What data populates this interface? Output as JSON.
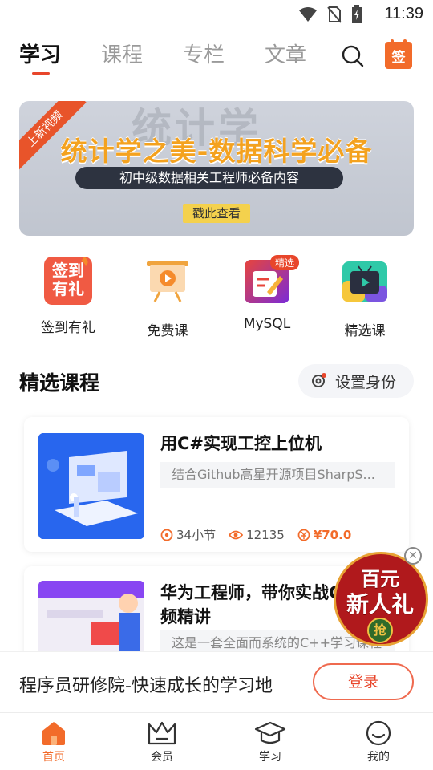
{
  "status_bar": {
    "time": "11:39"
  },
  "top_tabs": [
    {
      "label": "学习",
      "active": true
    },
    {
      "label": "课程",
      "active": false
    },
    {
      "label": "专栏",
      "active": false
    },
    {
      "label": "文章",
      "active": false
    }
  ],
  "sign_badge": "签",
  "banner": {
    "ribbon": "上新视频",
    "ghost_text": "统计学",
    "title": "统计学之美-数据科学必备",
    "subtitle": "初中级数据相关工程师必备内容",
    "cta": "戳此查看"
  },
  "quick_menu": [
    {
      "label": "签到有礼",
      "icon": "gift-checkin-icon",
      "icon_text": "签到有礼"
    },
    {
      "label": "免费课",
      "icon": "play-board-icon"
    },
    {
      "label": "MySQL",
      "icon": "mysql-edit-icon",
      "badge": "精选"
    },
    {
      "label": "精选课",
      "icon": "tv-icon"
    }
  ],
  "section": {
    "title": "精选课程",
    "identity_button": "设置身份"
  },
  "courses": [
    {
      "title": "用C#实现工控上位机",
      "desc": "结合Github高星开源项目SharpS...",
      "lessons": "34小节",
      "views": "12135",
      "price": "¥70.0"
    },
    {
      "title": "华为工程师，带你实战C++视频精讲",
      "desc": "这是一套全面而系统的C++学习课程"
    }
  ],
  "promo": {
    "line1": "百元",
    "line2": "新人礼",
    "grab": "抢"
  },
  "login_strip": {
    "slogan": "程序员研修院-快速成长的学习地",
    "login_button": "登录"
  },
  "bottom_nav": [
    {
      "label": "首页",
      "active": true
    },
    {
      "label": "会员",
      "active": false
    },
    {
      "label": "学习",
      "active": false
    },
    {
      "label": "我的",
      "active": false
    }
  ],
  "colors": {
    "accent": "#f26b2a",
    "red": "#e8462b",
    "banner_title": "#f4a21f"
  }
}
